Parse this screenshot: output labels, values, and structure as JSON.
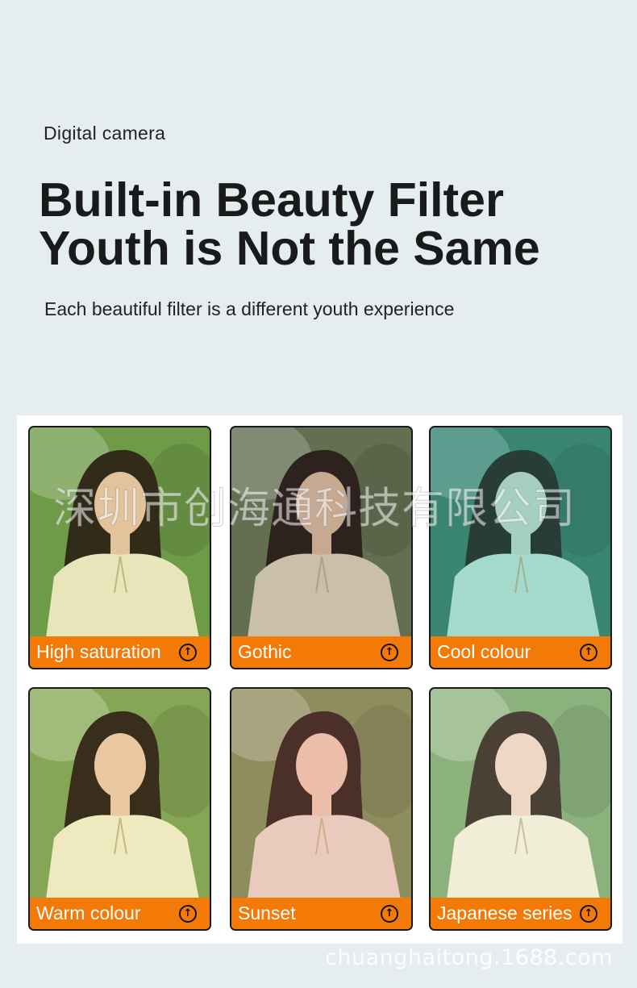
{
  "header": {
    "eyebrow": "Digital camera",
    "headline_line1": "Built-in Beauty Filter",
    "headline_line2": "Youth is Not the Same",
    "subtitle": "Each beautiful filter is a different youth experience"
  },
  "filters": [
    {
      "label": "High saturation",
      "icon": "arrow-up-circle-icon",
      "bg": "#6d9a4a",
      "skin": "#f0c7a8",
      "shirt": "#f6edc9",
      "tint": "rgba(120,170,60,0.10)"
    },
    {
      "label": "Gothic",
      "icon": "arrow-up-circle-icon",
      "bg": "#6c7a55",
      "skin": "#e6c1a4",
      "shirt": "#e9dcc0",
      "tint": "rgba(60,60,60,0.18)"
    },
    {
      "label": "Cool colour",
      "icon": "arrow-up-circle-icon",
      "bg": "#3f7c66",
      "skin": "#cfe0cc",
      "shirt": "#cdeedd",
      "tint": "rgba(40,160,150,0.25)"
    },
    {
      "label": "Warm colour",
      "icon": "arrow-up-circle-icon",
      "bg": "#7ea455",
      "skin": "#f0c9a9",
      "shirt": "#f3efcb",
      "tint": "rgba(200,190,80,0.10)"
    },
    {
      "label": "Sunset",
      "icon": "arrow-up-circle-icon",
      "bg": "#7c8e57",
      "skin": "#efc8b3",
      "shirt": "#ecd8cc",
      "tint": "rgba(220,140,120,0.18)"
    },
    {
      "label": "Japanese series",
      "icon": "arrow-up-circle-icon",
      "bg": "#79a66d",
      "skin": "#f2d5c4",
      "shirt": "#f6f1dc",
      "tint": "rgba(220,230,200,0.18)"
    }
  ],
  "watermarks": {
    "company": "深圳市创海通科技有限公司",
    "site": "chuanghaitong.1688.com"
  }
}
